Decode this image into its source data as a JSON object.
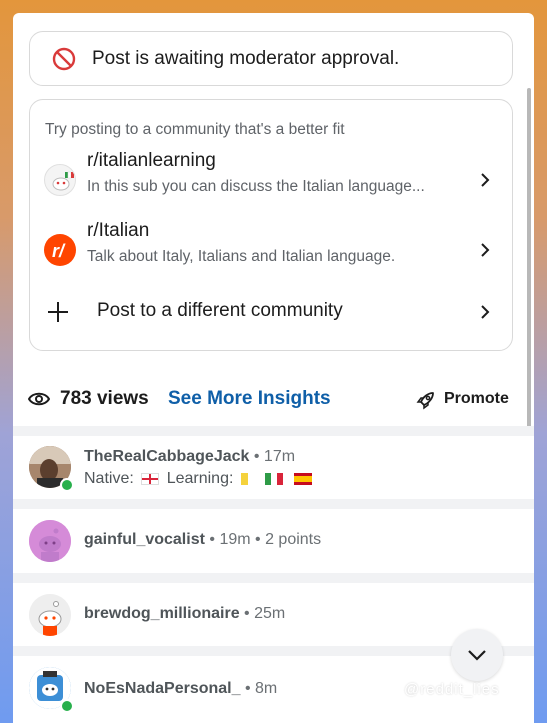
{
  "notice": {
    "text": "Post is awaiting moderator approval."
  },
  "suggestions": {
    "hint": "Try posting to a community that's a better fit",
    "communities": [
      {
        "name": "r/italianlearning",
        "description": "In this sub you can discuss the Italian language..."
      },
      {
        "name": "r/Italian",
        "description": "Talk about Italy, Italians and Italian language."
      }
    ],
    "other_label": "Post to a different community"
  },
  "stats": {
    "views": "783 views",
    "insights_label": "See More Insights",
    "promote_label": "Promote"
  },
  "comments": [
    {
      "user": "TheRealCabbageJack",
      "sep": "•",
      "meta": "17m",
      "flair_native": "Native:",
      "flair_learning": "Learning:"
    },
    {
      "user": "gainful_vocalist",
      "sep": "•",
      "meta": "19m",
      "sep2": "•",
      "points": "2 points"
    },
    {
      "user": "brewdog_millionaire",
      "sep": "•",
      "meta": "25m"
    },
    {
      "user": "NoEsNadaPersonal_",
      "sep": "•",
      "meta": "8m"
    }
  ],
  "watermark": "@reddit_lies",
  "colors": {
    "link": "#0f5fa8",
    "ban": "#d93a3a",
    "reddit_orange": "#ff4500",
    "online": "#28b04c"
  },
  "icons": [
    "ban-icon",
    "chevron-right-icon",
    "plus-icon",
    "eye-icon",
    "rocket-icon",
    "chevron-down-icon"
  ]
}
